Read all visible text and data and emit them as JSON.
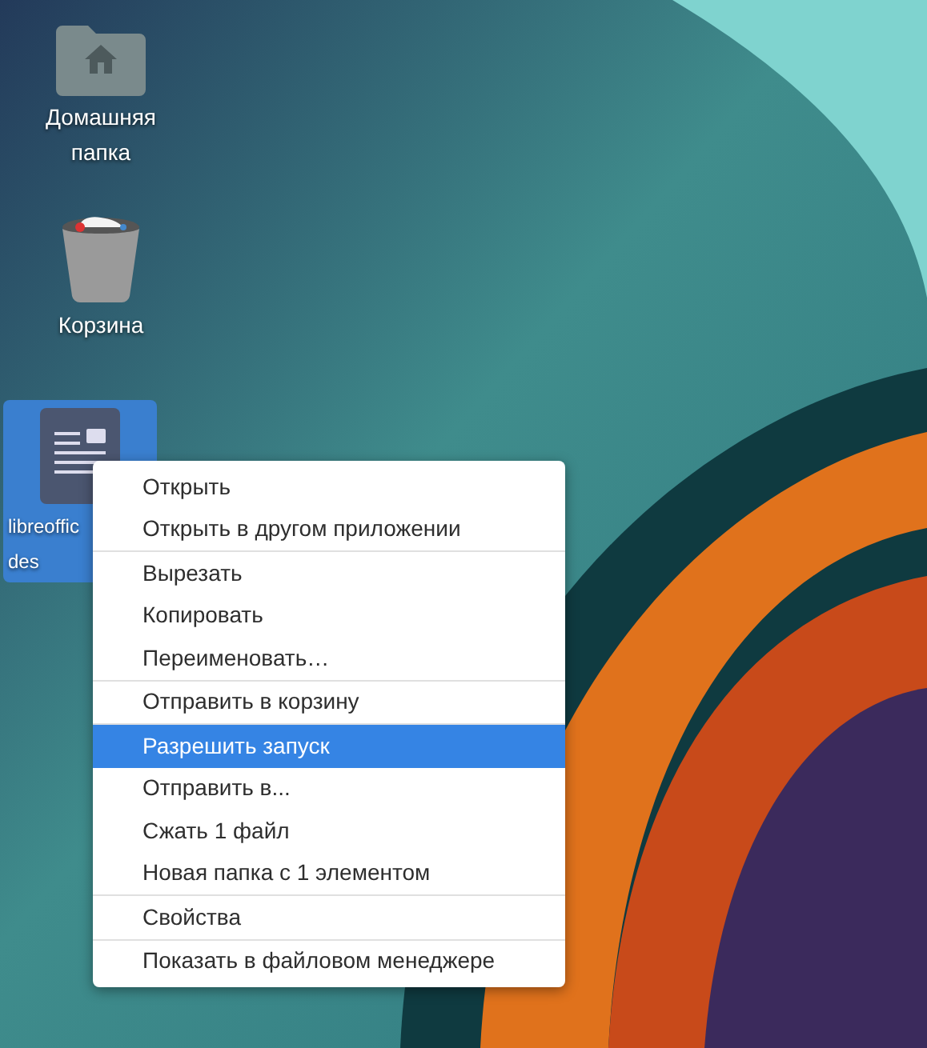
{
  "desktop_icons": [
    {
      "kind": "home-folder",
      "label_lines": [
        "Домашняя",
        "папка"
      ],
      "selected": false
    },
    {
      "kind": "trash",
      "label_lines": [
        "Корзина"
      ],
      "selected": false
    },
    {
      "kind": "document",
      "label_lines": [
        "libreoffic",
        "des"
      ],
      "selected": true
    }
  ],
  "context_menu": {
    "groups": [
      [
        {
          "label": "Открыть",
          "selected": false
        },
        {
          "label": "Открыть в другом приложении",
          "selected": false
        }
      ],
      [
        {
          "label": "Вырезать",
          "selected": false
        },
        {
          "label": "Копировать",
          "selected": false
        },
        {
          "label": "Переименовать…",
          "selected": false
        }
      ],
      [
        {
          "label": "Отправить в корзину",
          "selected": false
        }
      ],
      [
        {
          "label": "Разрешить запуск",
          "selected": true
        },
        {
          "label": "Отправить в...",
          "selected": false
        },
        {
          "label": "Сжать 1 файл",
          "selected": false
        },
        {
          "label": "Новая папка с 1 элементом",
          "selected": false
        }
      ],
      [
        {
          "label": "Свойства",
          "selected": false
        }
      ],
      [
        {
          "label": "Показать в файловом менеджере",
          "selected": false
        }
      ]
    ]
  }
}
